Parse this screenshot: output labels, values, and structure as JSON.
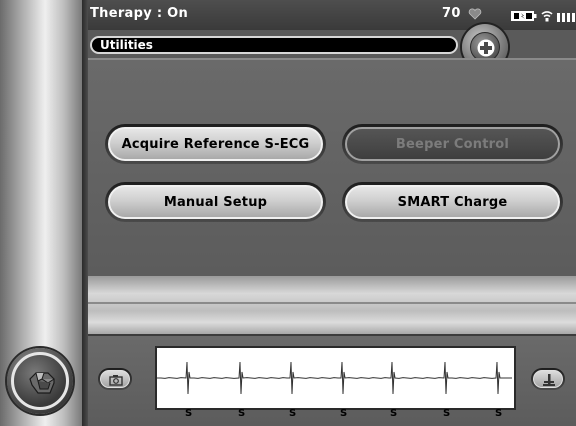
{
  "status_bar": {
    "therapy_status": "Therapy : On",
    "heart_rate": "70",
    "icons": [
      "heart-icon",
      "battery-icon",
      "telemetry-icon",
      "signal-strength-icon"
    ]
  },
  "title_bar": {
    "title": "Utilities",
    "add_button_icon": "plus-icon"
  },
  "buttons": {
    "acquire_reference": "Acquire Reference S-ECG",
    "beeper_control": "Beeper Control",
    "manual_setup": "Manual Setup",
    "smart_charge": "SMART Charge"
  },
  "ecg": {
    "beat_labels": [
      "S",
      "S",
      "S",
      "S",
      "S",
      "S",
      "S"
    ],
    "capture_button_icon": "capture-icon",
    "marker_button_icon": "marker-icon"
  },
  "home_button": {
    "icon": "hand-icon"
  },
  "colors": {
    "disabled_text": "#7c7c7c",
    "button_face": "#cfcfcf",
    "background": "#5a5a5a"
  }
}
